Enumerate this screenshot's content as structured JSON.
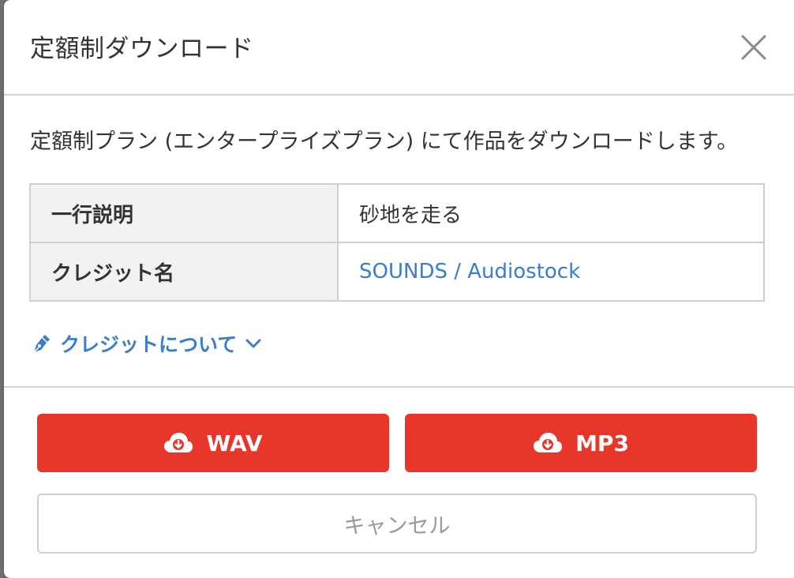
{
  "modal": {
    "title": "定額制ダウンロード",
    "description": "定額制プラン (エンタープライズプラン) にて作品をダウンロードします。",
    "table": [
      {
        "label": "一行説明",
        "value": "砂地を走る"
      },
      {
        "label": "クレジット名",
        "value": "SOUNDS / Audiostock"
      }
    ],
    "credit_toggle_label": "クレジットについて",
    "buttons": {
      "wav_label": "WAV",
      "mp3_label": "MP3",
      "cancel_label": "キャンセル"
    }
  },
  "colors": {
    "accent_red": "#e8362a",
    "link_blue": "#3a7dc9"
  },
  "icons": {
    "close": "close-icon",
    "pen": "pen-icon",
    "chevron": "chevron-down-icon",
    "cloud_download": "cloud-download-icon"
  }
}
